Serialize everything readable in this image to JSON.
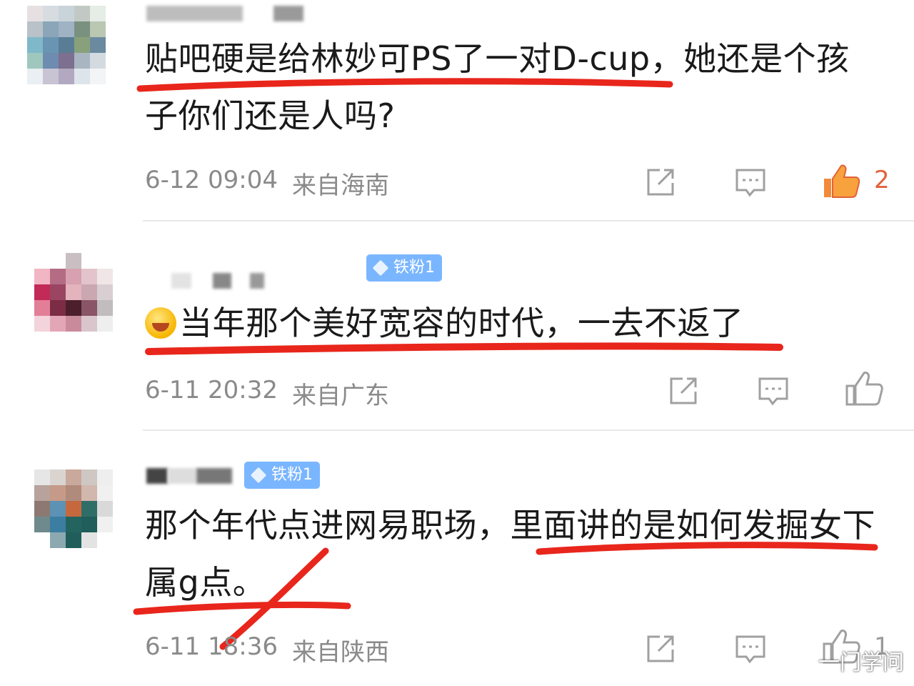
{
  "comments": [
    {
      "text": "贴吧硬是给林妙可PS了一对D-cup，她还是个孩子你们还是人吗?",
      "time": "6-12 09:04",
      "location": "来自海南",
      "likes": "2",
      "liked": true
    },
    {
      "badge": "铁粉1",
      "text": "当年那个美好宽容的时代，一去不返了",
      "time": "6-11 20:32",
      "location": "来自广东",
      "likes": "",
      "liked": false
    },
    {
      "badge": "铁粉1",
      "text": "那个年代点进网易职场，里面讲的是如何发掘女下属g点。",
      "time": "6-11 18:36",
      "location": "来自陕西",
      "likes": "1",
      "liked": false
    }
  ],
  "icons": {
    "share": "share-icon",
    "comment": "comment-icon",
    "like": "thumbs-up-icon"
  },
  "colors": {
    "annotation_red": "#e8261c",
    "like_active": "#e3613a",
    "badge_bg": "#7ab6ff"
  },
  "watermark": "一门学问"
}
